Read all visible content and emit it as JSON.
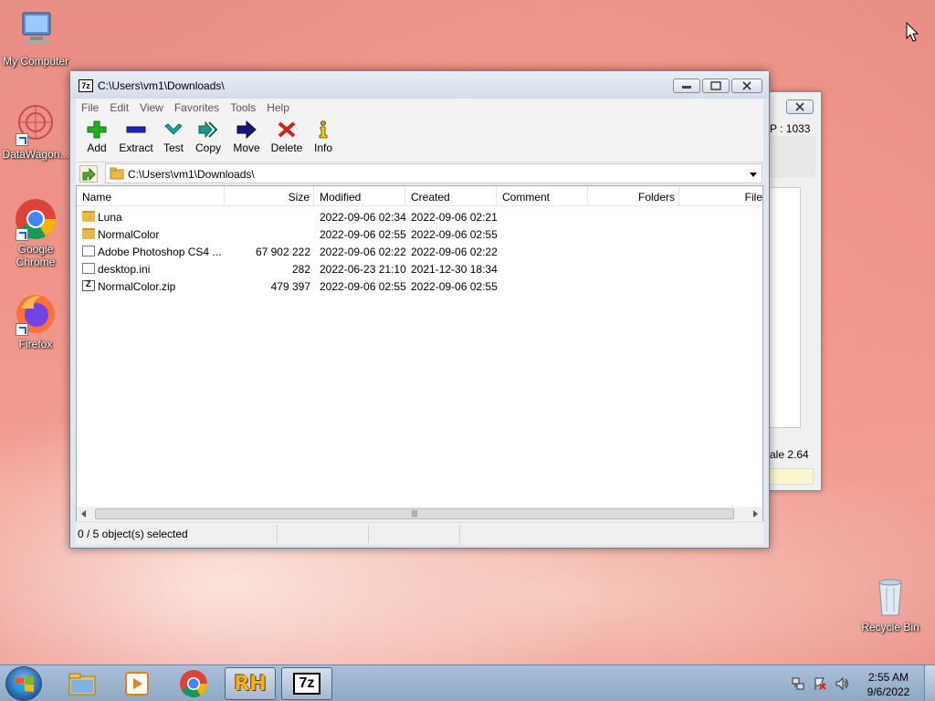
{
  "desktop": {
    "icons": [
      {
        "label": "My Computer"
      },
      {
        "label": "DataWagon..."
      },
      {
        "label": "Google Chrome"
      },
      {
        "label": "Firefox"
      },
      {
        "label": "Recycle Bin"
      }
    ]
  },
  "bg_window": {
    "text1": "P : 1033",
    "text2": "ale 2.64"
  },
  "window": {
    "title": "C:\\Users\\vm1\\Downloads\\",
    "app_icon": "7z",
    "menu": [
      "File",
      "Edit",
      "View",
      "Favorites",
      "Tools",
      "Help"
    ],
    "toolbar": [
      {
        "label": "Add",
        "icon": "plus-icon",
        "color": "#22b022"
      },
      {
        "label": "Extract",
        "icon": "minus-icon",
        "color": "#2222c0"
      },
      {
        "label": "Test",
        "icon": "check-icon",
        "color": "#1aa6a6"
      },
      {
        "label": "Copy",
        "icon": "double-arrow-icon",
        "color": "#1e9a8c"
      },
      {
        "label": "Move",
        "icon": "arrow-right-icon",
        "color": "#15157a"
      },
      {
        "label": "Delete",
        "icon": "x-icon",
        "color": "#d22020"
      },
      {
        "label": "Info",
        "icon": "info-icon",
        "color": "#c8a000"
      }
    ],
    "address": "C:\\Users\\vm1\\Downloads\\",
    "columns": [
      "Name",
      "Size",
      "Modified",
      "Created",
      "Comment",
      "Folders",
      "File"
    ],
    "files": [
      {
        "name": "Luna",
        "size": "",
        "modified": "2022-09-06 02:34",
        "created": "2022-09-06 02:21",
        "type": "folder"
      },
      {
        "name": "NormalColor",
        "size": "",
        "modified": "2022-09-06 02:55",
        "created": "2022-09-06 02:55",
        "type": "folder"
      },
      {
        "name": "Adobe Photoshop CS4 ...",
        "size": "67 902 222",
        "modified": "2022-09-06 02:22",
        "created": "2022-09-06 02:22",
        "type": "exe"
      },
      {
        "name": "desktop.ini",
        "size": "282",
        "modified": "2022-06-23 21:10",
        "created": "2021-12-30 18:34",
        "type": "ini"
      },
      {
        "name": "NormalColor.zip",
        "size": "479 397",
        "modified": "2022-09-06 02:55",
        "created": "2022-09-06 02:55",
        "type": "zip"
      }
    ],
    "status": "0 / 5 object(s) selected"
  },
  "taskbar": {
    "items": [
      "windows-explorer",
      "media-player",
      "chrome",
      "resource-hacker",
      "7zip"
    ],
    "rh_label": "RH",
    "sevenzip_label": "7z",
    "time": "2:55 AM",
    "date": "9/6/2022"
  }
}
